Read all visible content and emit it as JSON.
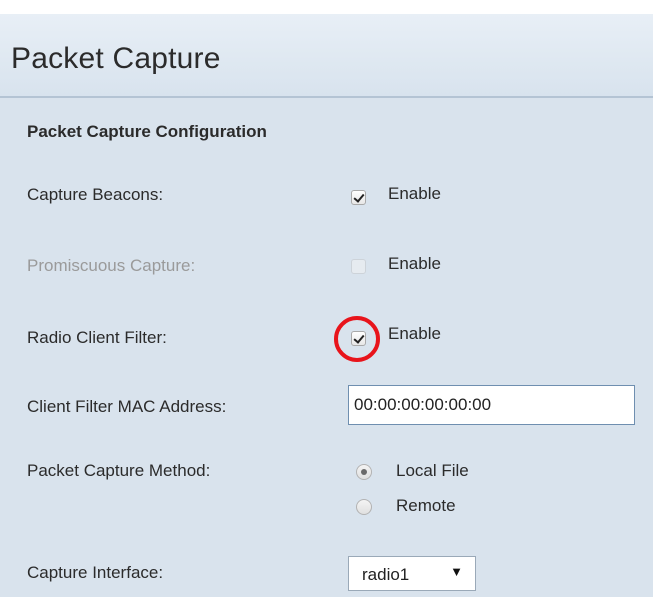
{
  "header": {
    "title": "Packet Capture"
  },
  "section": {
    "title": "Packet Capture Configuration"
  },
  "fields": {
    "capture_beacons": {
      "label": "Capture Beacons:",
      "checkbox_label": "Enable",
      "checked": true,
      "disabled": false
    },
    "promiscuous_capture": {
      "label": "Promiscuous Capture:",
      "checkbox_label": "Enable",
      "checked": false,
      "disabled": true
    },
    "radio_client_filter": {
      "label": "Radio Client Filter:",
      "checkbox_label": "Enable",
      "checked": true,
      "disabled": false,
      "highlight_color": "#e8141b"
    },
    "client_filter_mac": {
      "label": "Client Filter MAC Address:",
      "value": "00:00:00:00:00:00"
    },
    "packet_capture_method": {
      "label": "Packet Capture Method:",
      "options": [
        {
          "label": "Local File",
          "selected": true
        },
        {
          "label": "Remote",
          "selected": false
        }
      ]
    },
    "capture_interface": {
      "label": "Capture Interface:",
      "value": "radio1",
      "arrow_icon": "dropdown-arrow-icon"
    }
  },
  "colors": {
    "panel_background": "#d9e3ed",
    "header_background": "#e1e9f2",
    "disabled_text": "#9a9a9a"
  }
}
